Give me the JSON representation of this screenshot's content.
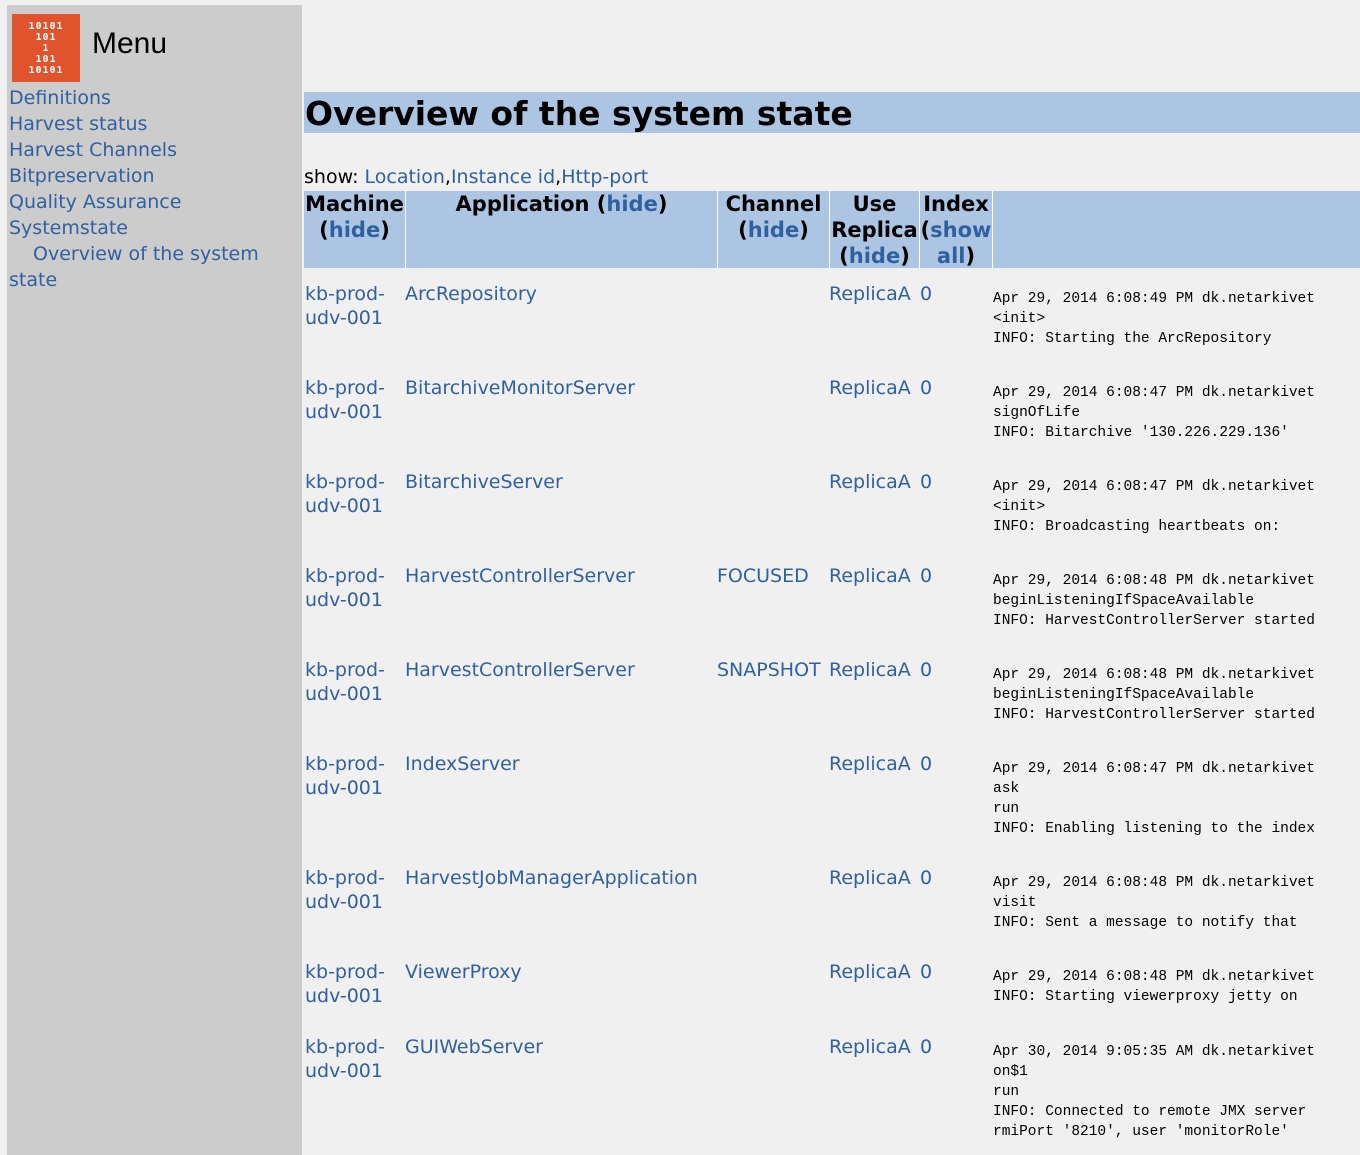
{
  "sidebar": {
    "logo_lines": [
      "10101",
      "101",
      "1",
      "101",
      "10101"
    ],
    "title": "Menu",
    "items": [
      {
        "label": "Definitions"
      },
      {
        "label": "Harvest status"
      },
      {
        "label": "Harvest Channels"
      },
      {
        "label": "Bitpreservation"
      },
      {
        "label": "Quality Assurance"
      },
      {
        "label": "Systemstate"
      }
    ],
    "subitem": {
      "label_a": "Overview of the system",
      "label_b": "state"
    }
  },
  "main": {
    "heading": "Overview of the system state",
    "show_prefix": "show: ",
    "show_links": [
      "Location",
      "Instance id",
      "Http-port"
    ],
    "columns": {
      "machine": "Machine",
      "application": "Application",
      "channel": "Channel",
      "use_replica_a": "Use",
      "use_replica_b": "Replica",
      "index": "Index",
      "hide": "hide",
      "show": "show",
      "all": "all"
    },
    "rows": [
      {
        "machine_a": "kb-prod-",
        "machine_b": "udv-001",
        "application": "ArcRepository",
        "channel": "",
        "replica": "ReplicaA",
        "index": "0",
        "message": "Apr 29, 2014 6:08:49 PM dk.netarkivet\n<init>\nINFO: Starting the ArcRepository"
      },
      {
        "machine_a": "kb-prod-",
        "machine_b": "udv-001",
        "application": "BitarchiveMonitorServer",
        "channel": "",
        "replica": "ReplicaA",
        "index": "0",
        "message": "Apr 29, 2014 6:08:47 PM dk.netarkivet\nsignOfLife\nINFO: Bitarchive '130.226.229.136'"
      },
      {
        "machine_a": "kb-prod-",
        "machine_b": "udv-001",
        "application": "BitarchiveServer",
        "channel": "",
        "replica": "ReplicaA",
        "index": "0",
        "message": "Apr 29, 2014 6:08:47 PM dk.netarkivet\n<init>\nINFO: Broadcasting heartbeats on:"
      },
      {
        "machine_a": "kb-prod-",
        "machine_b": "udv-001",
        "application": "HarvestControllerServer",
        "channel": "FOCUSED",
        "replica": "ReplicaA",
        "index": "0",
        "message": "Apr 29, 2014 6:08:48 PM dk.netarkivet\nbeginListeningIfSpaceAvailable\nINFO: HarvestControllerServer started"
      },
      {
        "machine_a": "kb-prod-",
        "machine_b": "udv-001",
        "application": "HarvestControllerServer",
        "channel": "SNAPSHOT",
        "replica": "ReplicaA",
        "index": "0",
        "message": "Apr 29, 2014 6:08:48 PM dk.netarkivet\nbeginListeningIfSpaceAvailable\nINFO: HarvestControllerServer started"
      },
      {
        "machine_a": "kb-prod-",
        "machine_b": "udv-001",
        "application": "IndexServer",
        "channel": "",
        "replica": "ReplicaA",
        "index": "0",
        "message": "Apr 29, 2014 6:08:47 PM dk.netarkivet\nask\nrun\nINFO: Enabling listening to the index"
      },
      {
        "machine_a": "kb-prod-",
        "machine_b": "udv-001",
        "application": "HarvestJobManagerApplication",
        "channel": "",
        "replica": "ReplicaA",
        "index": "0",
        "message": "Apr 29, 2014 6:08:48 PM dk.netarkivet\nvisit\nINFO: Sent a message to notify that"
      },
      {
        "machine_a": "kb-prod-",
        "machine_b": "udv-001",
        "application": "ViewerProxy",
        "channel": "",
        "replica": "ReplicaA",
        "index": "0",
        "message": "Apr 29, 2014 6:08:48 PM dk.netarkivet\nINFO: Starting viewerproxy jetty on"
      },
      {
        "machine_a": "kb-prod-",
        "machine_b": "udv-001",
        "application": "GUIWebServer",
        "channel": "",
        "replica": "ReplicaA",
        "index": "0",
        "message": "Apr 30, 2014 9:05:35 AM dk.netarkivet\non$1\nrun\nINFO: Connected to remote JMX server\nrmiPort '8210', user 'monitorRole'"
      }
    ]
  }
}
